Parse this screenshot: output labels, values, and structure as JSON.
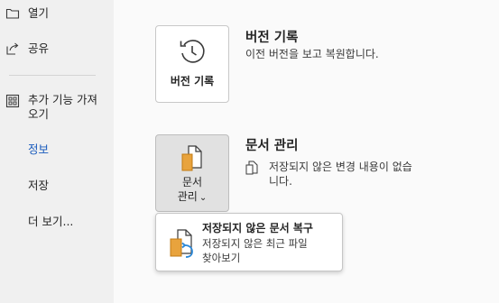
{
  "sidebar": {
    "items": [
      {
        "label": "열기",
        "icon": "folder-icon"
      },
      {
        "label": "공유",
        "icon": "share-icon"
      },
      {
        "label": "추가 기능 가져오기",
        "icon": "add-ins-icon"
      },
      {
        "label": "정보",
        "icon": ""
      },
      {
        "label": "저장",
        "icon": ""
      },
      {
        "label": "더 보기...",
        "icon": ""
      }
    ]
  },
  "version_history": {
    "button_label": "버전 기록",
    "title": "버전 기록",
    "description": "이전 버전을 보고 복원합니다."
  },
  "manage_document": {
    "button_label_line1": "문서",
    "button_label_line2": "관리",
    "button_chevron": "⌄",
    "title": "문서 관리",
    "description_line1": "저장되지 않은 변경 내용이 없습",
    "description_line2": "니다."
  },
  "recover_menu": {
    "title": "저장되지 않은 문서 복구",
    "description_line1": "저장되지 않은 최근 파일",
    "description_line2": "찾아보기"
  },
  "colors": {
    "accent": "#185abd",
    "doc_orange": "#e8a33d",
    "recover_blue": "#2b88d8"
  }
}
